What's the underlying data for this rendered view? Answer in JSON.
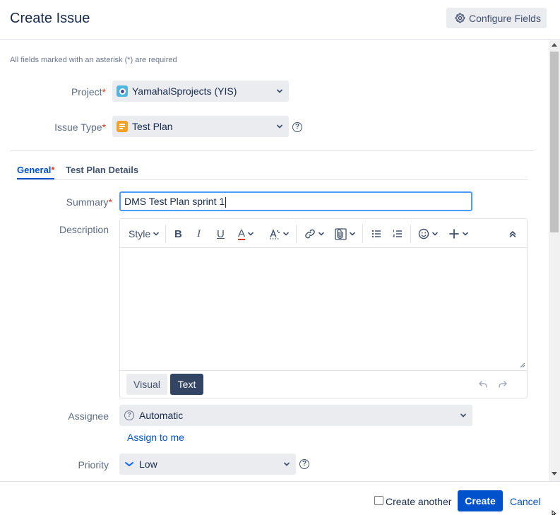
{
  "dialog": {
    "title": "Create Issue",
    "configure_fields_label": "Configure Fields"
  },
  "form": {
    "required_note": "All fields marked with an asterisk (*) are required",
    "required_mark": "*",
    "project": {
      "label": "Project",
      "value": "YamahalSprojects (YIS)"
    },
    "issue_type": {
      "label": "Issue Type",
      "value": "Test Plan"
    },
    "tabs": [
      {
        "label": "General",
        "required": true,
        "active": true
      },
      {
        "label": "Test Plan Details",
        "required": false,
        "active": false
      }
    ],
    "summary": {
      "label": "Summary",
      "value": "DMS Test Plan sprint 1"
    },
    "description": {
      "label": "Description",
      "toolbar_style_label": "Style",
      "modes": {
        "visual": "Visual",
        "text": "Text",
        "active": "Text"
      }
    },
    "assignee": {
      "label": "Assignee",
      "value": "Automatic",
      "assign_to_me": "Assign to me"
    },
    "priority": {
      "label": "Priority",
      "value": "Low"
    }
  },
  "footer": {
    "create_another_label": "Create another",
    "create_another_checked": false,
    "create_label": "Create",
    "cancel_label": "Cancel"
  },
  "colors": {
    "primary": "#0052cc",
    "required": "#de350b",
    "text_mode_bg": "#344563",
    "issue_type_icon": "#f6a125",
    "project_icon": "#4fb6e3"
  },
  "icons": {
    "configure": "gear-icon",
    "priority_low": "chevron-down-blue-icon",
    "help": "question-circle-icon"
  }
}
